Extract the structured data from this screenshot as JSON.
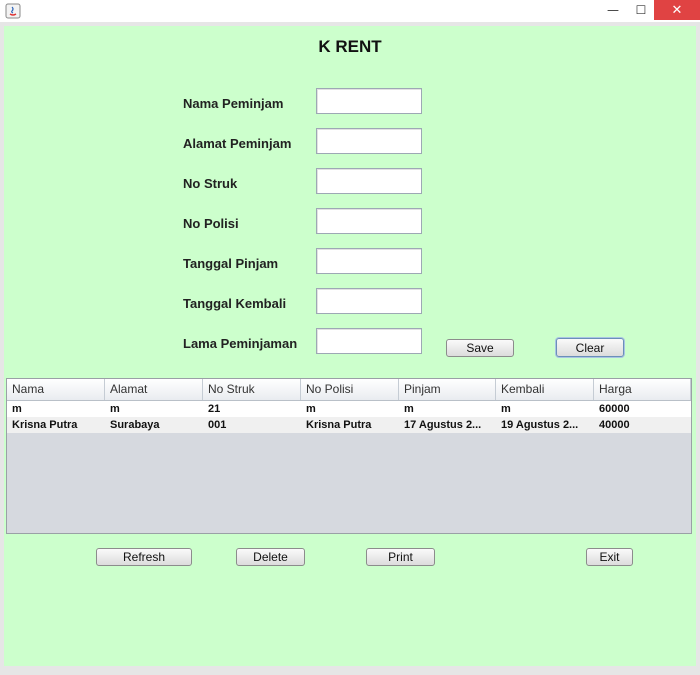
{
  "window": {
    "minimize_glyph": "—",
    "maximize_glyph": "☐",
    "close_glyph": "✕",
    "app_icon": "java-icon"
  },
  "header": {
    "title": "K RENT"
  },
  "form": {
    "fields": [
      {
        "label": "Nama Peminjam",
        "value": ""
      },
      {
        "label": "Alamat Peminjam",
        "value": ""
      },
      {
        "label": "No Struk",
        "value": ""
      },
      {
        "label": "No Polisi",
        "value": ""
      },
      {
        "label": "Tanggal Pinjam",
        "value": ""
      },
      {
        "label": "Tanggal Kembali",
        "value": ""
      },
      {
        "label": "Lama Peminjaman",
        "value": ""
      }
    ],
    "save_label": "Save",
    "clear_label": "Clear"
  },
  "table": {
    "columns": [
      "Nama",
      "Alamat",
      "No Struk",
      "No Polisi",
      "Pinjam",
      "Kembali",
      "Harga"
    ],
    "rows": [
      [
        "m",
        "m",
        "21",
        "m",
        "m",
        "m",
        "60000"
      ],
      [
        "Krisna Putra",
        "Surabaya",
        "001",
        "Krisna Putra",
        "17 Agustus 2...",
        "19 Agustus 2...",
        "40000"
      ]
    ]
  },
  "actions": {
    "refresh_label": "Refresh",
    "delete_label": "Delete",
    "print_label": "Print",
    "exit_label": "Exit"
  },
  "colors": {
    "panel_bg": "#ccffcc",
    "close_button": "#e04343",
    "table_empty_bg": "#d6d9df"
  }
}
